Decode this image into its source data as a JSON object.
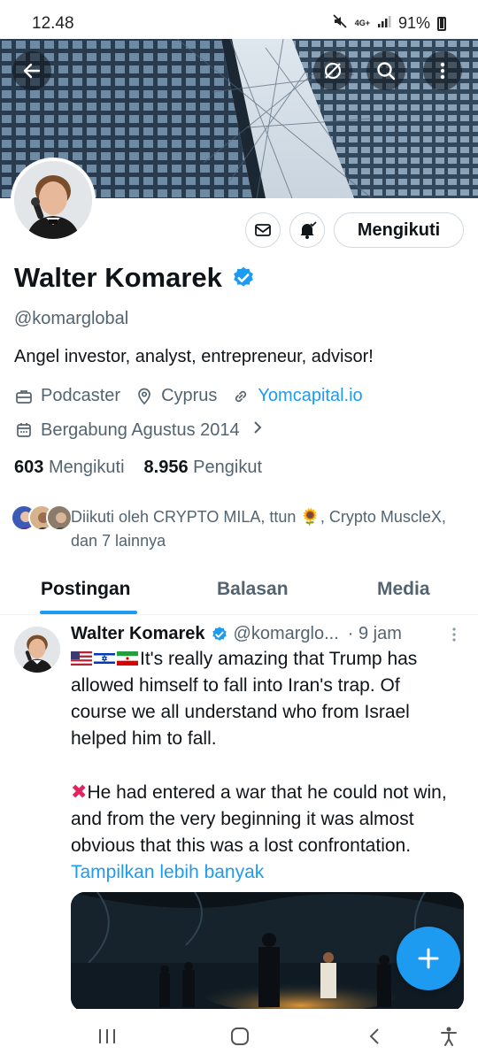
{
  "status_bar": {
    "time": "12.48",
    "network": "4G+",
    "battery": "91%",
    "icons": [
      "mute-icon",
      "network-icon",
      "signal-icon",
      "battery-icon"
    ]
  },
  "header_actions": [
    "back-arrow-icon",
    "grok-icon",
    "search-icon",
    "more-vertical-icon"
  ],
  "profile": {
    "name": "Walter Komarek",
    "verified": true,
    "handle": "@komarglobal",
    "bio": "Angel investor, analyst, entrepreneur, advisor!",
    "category": "Podcaster",
    "location": "Cyprus",
    "website": "Yomcapital.io",
    "joined": "Bergabung Agustus 2014",
    "following_count": "603",
    "following_label": "Mengikuti",
    "followers_count": "8.956",
    "followers_label": "Pengikut",
    "follow_button": "Mengikuti",
    "followed_by_text": "Diikuti oleh CRYPTO MILA, ttun 🌻, Crypto MuscleX, dan 7 lainnya"
  },
  "tabs": [
    {
      "label": "Postingan",
      "active": true
    },
    {
      "label": "Balasan",
      "active": false
    },
    {
      "label": "Media",
      "active": false
    }
  ],
  "post": {
    "author": "Walter Komarek",
    "handle": "@komarglo...",
    "time": "· 9 jam",
    "flags": [
      "US",
      "IL",
      "IR"
    ],
    "paragraph1": "It's really amazing that Trump has allowed himself to fall into Iran's trap. Of course we all understand who from Israel helped him to fall.",
    "paragraph2": "He had entered a war that he could not win, and from the very beginning it was almost obvious that this was a lost confrontation.",
    "show_more": "Tampilkan lebih banyak"
  },
  "colors": {
    "accent": "#1d9bf0",
    "text_primary": "#0f1419",
    "text_secondary": "#536471",
    "border": "#cfd9de"
  }
}
